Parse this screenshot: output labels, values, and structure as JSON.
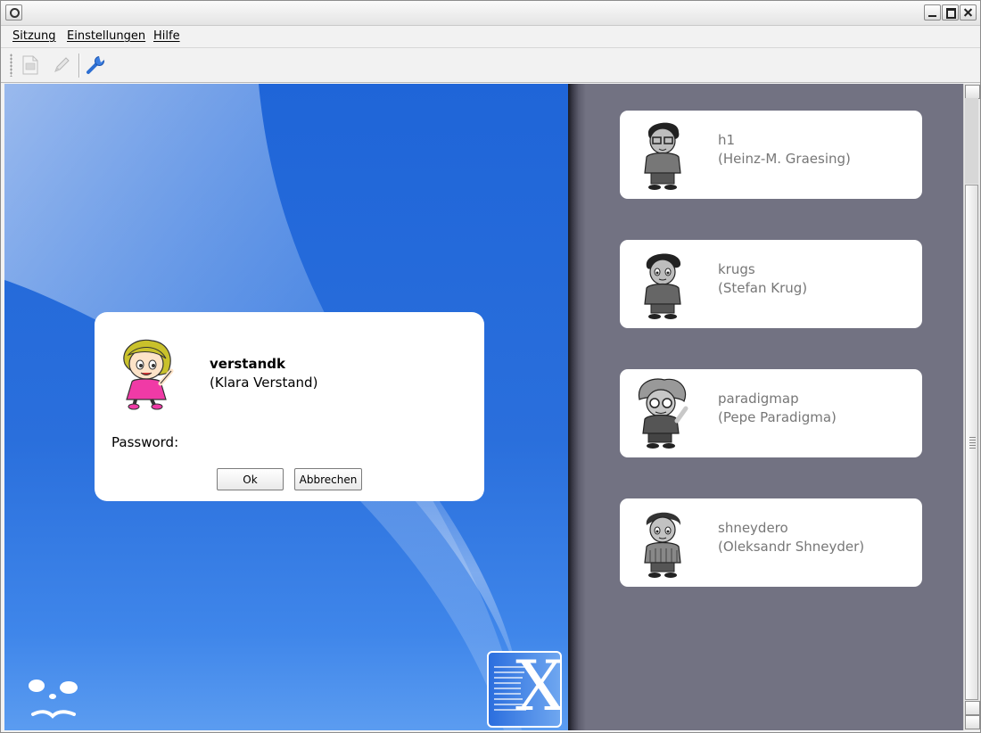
{
  "menu": {
    "items": [
      "Sitzung",
      "Einstellungen",
      "Hilfe"
    ]
  },
  "toolbar": {
    "icons": [
      "new-session-icon",
      "edit-session-icon",
      "settings-wrench-icon"
    ]
  },
  "login": {
    "username": "verstandk",
    "fullname": "(Klara Verstand)",
    "password_label": "Password:",
    "password_value": "",
    "ok_label": "Ok",
    "cancel_label": "Abbrechen"
  },
  "users": [
    {
      "username": "h1",
      "fullname": "(Heinz-M. Graesing)"
    },
    {
      "username": "krugs",
      "fullname": "(Stefan Krug)"
    },
    {
      "username": "paradigmap",
      "fullname": "(Pepe Paradigma)"
    },
    {
      "username": "shneydero",
      "fullname": "(Oleksandr Shneyder)"
    }
  ],
  "branding": {
    "logo_letter": "X"
  },
  "colors": {
    "background_blue": "#2a6fdc",
    "user_panel": "#727282",
    "avatar_pink": "#f03aa6",
    "avatar_hair": "#c9c12b"
  }
}
